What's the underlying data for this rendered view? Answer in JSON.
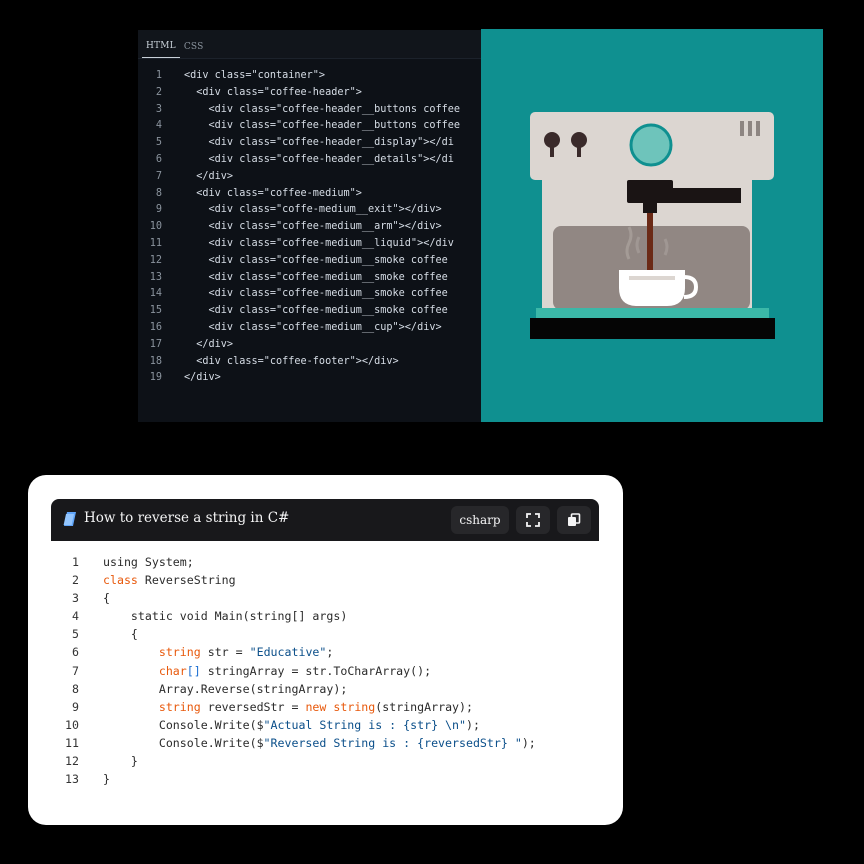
{
  "editor": {
    "tabs": [
      "HTML",
      "CSS"
    ],
    "line_numbers": [
      "1",
      "2",
      "3",
      "4",
      "5",
      "6",
      "7",
      "8",
      "9",
      "10",
      "11",
      "12",
      "13",
      "14",
      "15",
      "16",
      "17",
      "18",
      "19"
    ],
    "lines": [
      "<div class=\"container\">",
      "  <div class=\"coffee-header\">",
      "    <div class=\"coffee-header__buttons coffee",
      "    <div class=\"coffee-header__buttons coffee",
      "    <div class=\"coffee-header__display\"></di",
      "    <div class=\"coffee-header__details\"></di",
      "  </div>",
      "  <div class=\"coffee-medium\">",
      "    <div class=\"coffe-medium__exit\"></div>",
      "    <div class=\"coffee-medium__arm\"></div>",
      "    <div class=\"coffee-medium__liquid\"></div",
      "    <div class=\"coffee-medium__smoke coffee",
      "    <div class=\"coffee-medium__smoke coffee",
      "    <div class=\"coffee-medium__smoke coffee",
      "    <div class=\"coffee-medium__smoke coffee",
      "    <div class=\"coffee-medium__cup\"></div>",
      "  </div>",
      "  <div class=\"coffee-footer\"></div>",
      "</div>"
    ]
  },
  "preview": {
    "background": "#0f9090",
    "illustration": "espresso-machine"
  },
  "card": {
    "title": "How to reverse a string in C#",
    "title_icon": "book-icon",
    "language_label": "csharp",
    "fullscreen_icon": "fullscreen-icon",
    "copy_icon": "copy-icon",
    "line_numbers": [
      "1",
      "2",
      "3",
      "4",
      "5",
      "6",
      "7",
      "8",
      "9",
      "10",
      "11",
      "12",
      "13"
    ],
    "code": {
      "l1": "using System;",
      "l2_kw": "class",
      "l2_rest": " ReverseString",
      "l3": "{",
      "l4": "    static void Main(string[] args)",
      "l5": "    {",
      "l6_kw": "string",
      "l6_mid": " str = ",
      "l6_str": "\"Educative\"",
      "l6_end": ";",
      "l7_kw": "char",
      "l7_br": "[]",
      "l7_rest": " stringArray = str.ToCharArray();",
      "l8": "Array.Reverse(stringArray);",
      "l9_kw": "string",
      "l9_mid": " reversedStr = ",
      "l9_new": "new",
      "l9_kw2": "string",
      "l9_end": "(stringArray);",
      "l10_a": "Console.Write($",
      "l10_str": "\"Actual String is : {str} \\n\"",
      "l10_end": ");",
      "l11_a": "Console.Write($",
      "l11_str": "\"Reversed String is : {reversedStr} \"",
      "l11_end": ");",
      "l12": "    }",
      "l13": "}"
    }
  },
  "colors": {
    "teal": "#0f9090",
    "keyword": "#e8590c",
    "keyword_blue": "#1c6fd1",
    "string": "#0b4f8a"
  }
}
